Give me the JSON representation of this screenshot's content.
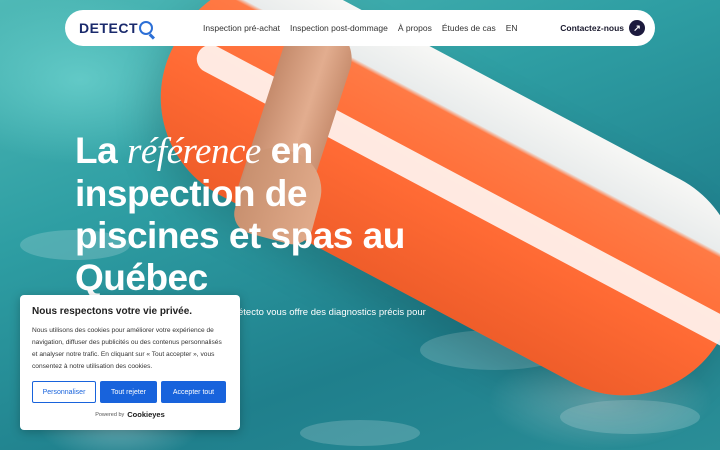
{
  "nav": {
    "logo_text": "DETECT",
    "links": [
      "Inspection pré-achat",
      "Inspection post-dommage",
      "À propos",
      "Études de cas",
      "EN"
    ],
    "contact_label": "Contactez-nous",
    "contact_icon": "arrow-up-right-icon"
  },
  "hero": {
    "headline_pre": "La ",
    "headline_em": "référence",
    "headline_post": " en inspection de piscines et spas au Québec",
    "subtitle": "étecto vous offre des diagnostics précis pour"
  },
  "cookie": {
    "title": "Nous respectons votre vie privée.",
    "text": "Nous utilisons des cookies pour améliorer votre expérience de navigation, diffuser des publicités ou des contenus personnalisés et analyser notre trafic. En cliquant sur « Tout accepter », vous consentez à notre utilisation des cookies.",
    "btn_customize": "Personnaliser",
    "btn_reject": "Tout rejeter",
    "btn_accept": "Accepter tout",
    "powered_by": "Powered by",
    "brand": "Cookieyes"
  },
  "colors": {
    "brand_navy": "#1a2a6c",
    "accent_blue": "#1863dc",
    "contact_circle": "#1c1a3d"
  }
}
